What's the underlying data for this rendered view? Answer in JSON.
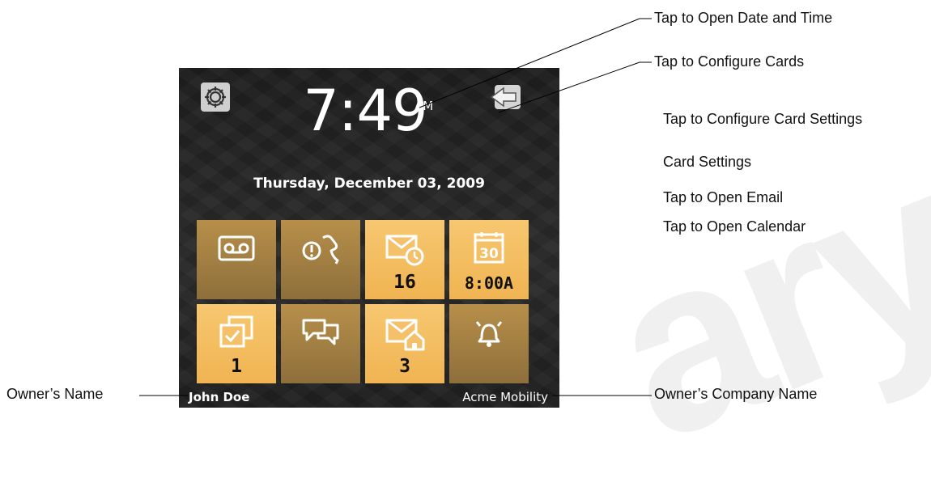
{
  "screen": {
    "time": "7:49",
    "ampm": "AM",
    "date": "Thursday, December 03, 2009",
    "owner_name": "John Doe",
    "company_name": "Acme Mobility",
    "cards": [
      {
        "icon": "voicemail-icon",
        "count": "",
        "active": false
      },
      {
        "icon": "missed-call-icon",
        "count": "",
        "active": false
      },
      {
        "icon": "email-clock-icon",
        "count": "16",
        "active": true
      },
      {
        "icon": "calendar-icon",
        "count": "8:00A",
        "active": true,
        "icon_text": "30"
      },
      {
        "icon": "tasks-icon",
        "count": "1",
        "active": true
      },
      {
        "icon": "messaging-icon",
        "count": "",
        "active": false
      },
      {
        "icon": "email-home-icon",
        "count": "3",
        "active": true
      },
      {
        "icon": "alarm-bell-icon",
        "count": "",
        "active": false
      }
    ]
  },
  "callouts": {
    "date_time": "Tap to Open Date and Time",
    "configure_cards": "Tap to Configure Cards",
    "card_settings_configure": "Tap to Configure Card Settings",
    "card_settings": "Card Settings",
    "open_email": "Tap to Open Email",
    "open_calendar": "Tap to Open Calendar",
    "owner_name": "Owner’s Name",
    "owner_company": "Owner’s Company Name"
  },
  "colors": {
    "card_active": "#f2b95a",
    "card_dim": "#a07f45",
    "screen_bg": "#222222"
  }
}
